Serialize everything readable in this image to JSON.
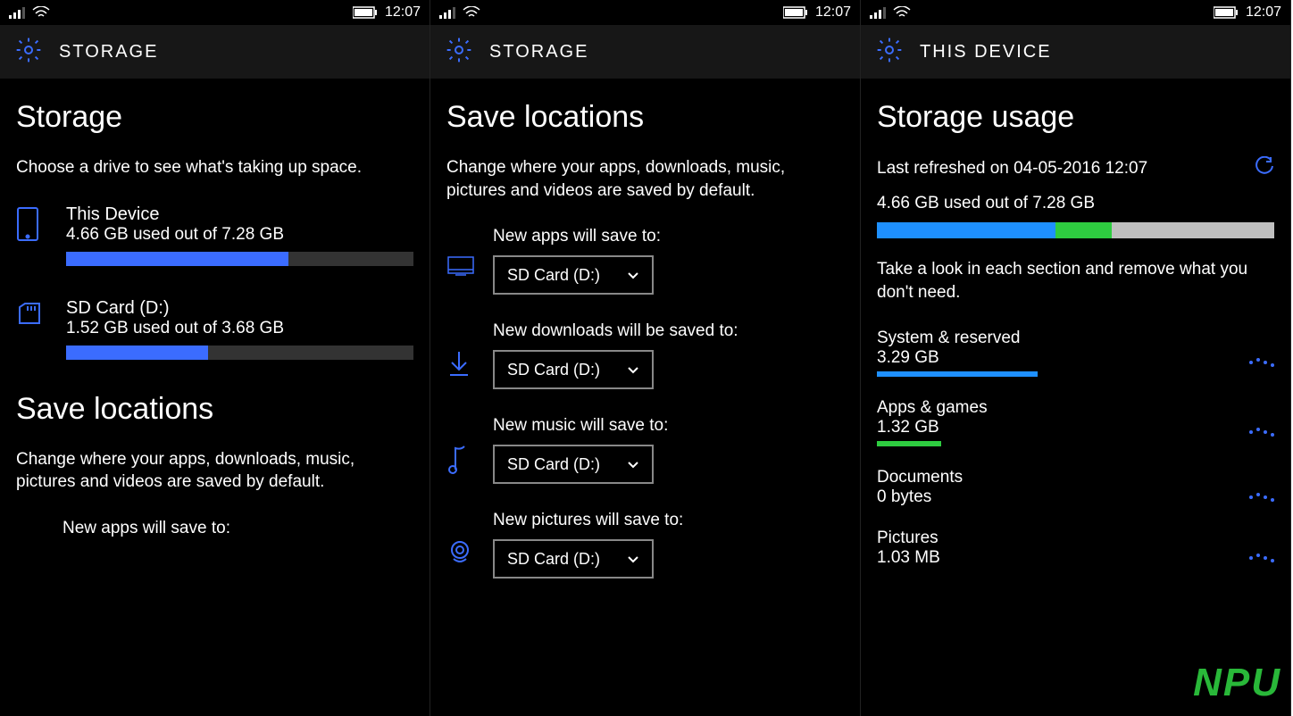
{
  "status": {
    "time": "12:07"
  },
  "screens": [
    {
      "header": "STORAGE",
      "title": "Storage",
      "intro": "Choose a drive to see what's taking up space.",
      "drives": [
        {
          "name": "This Device",
          "usage": "4.66 GB used out of 7.28 GB",
          "pct": 64,
          "icon": "phone"
        },
        {
          "name": "SD Card (D:)",
          "usage": "1.52 GB used out of 3.68 GB",
          "pct": 41,
          "icon": "sd"
        }
      ],
      "save_title": "Save locations",
      "save_intro": "Change where your apps, downloads, music, pictures and videos are saved by default.",
      "partial_label": "New apps will save to:"
    },
    {
      "header": "STORAGE",
      "title": "Save locations",
      "intro": "Change where your apps, downloads, music, pictures and videos are saved by default.",
      "rows": [
        {
          "label": "New apps will save to:",
          "value": "SD Card (D:)",
          "icon": "apps"
        },
        {
          "label": "New downloads will be saved to:",
          "value": "SD Card (D:)",
          "icon": "download"
        },
        {
          "label": "New music will save to:",
          "value": "SD Card (D:)",
          "icon": "music"
        },
        {
          "label": "New pictures will save to:",
          "value": "SD Card (D:)",
          "icon": "camera"
        }
      ]
    },
    {
      "header": "THIS DEVICE",
      "title": "Storage usage",
      "refreshed": "Last refreshed on 04-05-2016 12:07",
      "summary": "4.66 GB used out of 7.28 GB",
      "bar": {
        "blue": 45,
        "green": 14
      },
      "hint": "Take a look in each section and remove what you don't need.",
      "cats": [
        {
          "name": "System & reserved",
          "size": "3.29 GB",
          "color": "#1E90FF",
          "pct": 45
        },
        {
          "name": "Apps & games",
          "size": "1.32 GB",
          "color": "#2ECC40",
          "pct": 18
        },
        {
          "name": "Documents",
          "size": "0 bytes",
          "color": "transparent",
          "pct": 0
        },
        {
          "name": "Pictures",
          "size": "1.03 MB",
          "color": "transparent",
          "pct": 0
        }
      ],
      "watermark": "NPU"
    }
  ]
}
